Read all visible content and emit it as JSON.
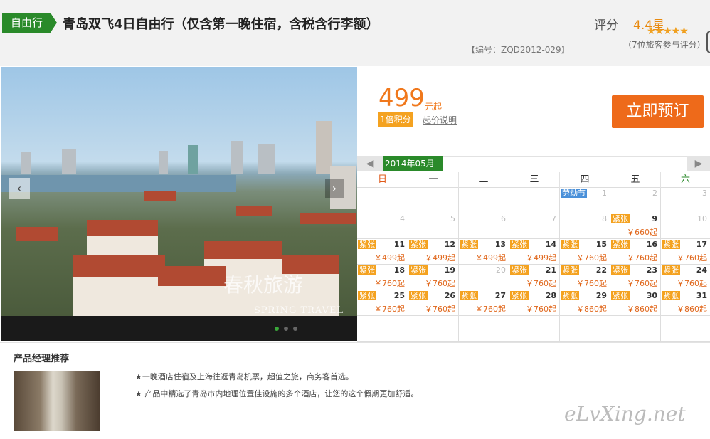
{
  "header": {
    "tag": "自由行",
    "title": "青岛双飞4日自由行（仅含第一晚住宿，含税含行李额）",
    "code": "【编号：ZQD2012-029】",
    "rating_label": "评分",
    "rating_value": "4.4星",
    "stars": "★★★★★",
    "reviews": "（7位旅客参与评分）"
  },
  "photo": {
    "watermark_cn": "春秋旅游",
    "watermark_en": "SPRING TRAVEL",
    "prev_icon": "‹",
    "next_icon": "›"
  },
  "pricing": {
    "price": "499",
    "unit": "元起",
    "points": "1倍积分",
    "price_note": "起价说明",
    "book_label": "立即预订"
  },
  "calendar": {
    "month": "2014年05月",
    "prev_icon": "◀",
    "next_icon": "▶",
    "weekdays": [
      "日",
      "一",
      "二",
      "三",
      "四",
      "五",
      "六"
    ],
    "weekday_colors": [
      "#e05a1a",
      "#333333",
      "#333333",
      "#333333",
      "#333333",
      "#333333",
      "#2a8a2a"
    ],
    "rows": [
      [
        {
          "d": ""
        },
        {
          "d": ""
        },
        {
          "d": ""
        },
        {
          "d": ""
        },
        {
          "d": "1",
          "past": true,
          "holiday": "劳动节"
        },
        {
          "d": "2",
          "past": true
        },
        {
          "d": "3",
          "past": true
        }
      ],
      [
        {
          "d": "4",
          "past": true
        },
        {
          "d": "5",
          "past": true
        },
        {
          "d": "6",
          "past": true
        },
        {
          "d": "7",
          "past": true
        },
        {
          "d": "8",
          "past": true
        },
        {
          "d": "9",
          "hot": "紧张",
          "price": "￥660起"
        },
        {
          "d": "10",
          "past": true
        }
      ],
      [
        {
          "d": "11",
          "hot": "紧张",
          "price": "￥499起"
        },
        {
          "d": "12",
          "hot": "紧张",
          "price": "￥499起"
        },
        {
          "d": "13",
          "hot": "紧张",
          "price": "￥499起"
        },
        {
          "d": "14",
          "hot": "紧张",
          "price": "￥499起"
        },
        {
          "d": "15",
          "hot": "紧张",
          "price": "￥760起"
        },
        {
          "d": "16",
          "hot": "紧张",
          "price": "￥760起"
        },
        {
          "d": "17",
          "hot": "紧张",
          "price": "￥760起"
        }
      ],
      [
        {
          "d": "18",
          "hot": "紧张",
          "price": "￥760起"
        },
        {
          "d": "19",
          "hot": "紧张",
          "price": "￥760起"
        },
        {
          "d": "20",
          "past": true
        },
        {
          "d": "21",
          "hot": "紧张",
          "price": "￥760起"
        },
        {
          "d": "22",
          "hot": "紧张",
          "price": "￥760起"
        },
        {
          "d": "23",
          "hot": "紧张",
          "price": "￥760起"
        },
        {
          "d": "24",
          "hot": "紧张",
          "price": "￥760起"
        }
      ],
      [
        {
          "d": "25",
          "hot": "紧张",
          "price": "￥760起"
        },
        {
          "d": "26",
          "hot": "紧张",
          "price": "￥760起"
        },
        {
          "d": "27",
          "hot": "紧张",
          "price": "￥760起"
        },
        {
          "d": "28",
          "hot": "紧张",
          "price": "￥760起"
        },
        {
          "d": "29",
          "hot": "紧张",
          "price": "￥860起"
        },
        {
          "d": "30",
          "hot": "紧张",
          "price": "￥860起"
        },
        {
          "d": "31",
          "hot": "紧张",
          "price": "￥860起"
        }
      ],
      [
        {
          "d": ""
        },
        {
          "d": ""
        },
        {
          "d": ""
        },
        {
          "d": ""
        },
        {
          "d": ""
        },
        {
          "d": ""
        },
        {
          "d": ""
        }
      ]
    ]
  },
  "recommend": {
    "title": "产品经理推荐",
    "tips": [
      "★一晚酒店住宿及上海往返青岛机票，超值之旅，商务客首选。",
      "★ 产品中精选了青岛市内地理位置佳设施的多个酒店，让您的这个假期更加舒适。"
    ]
  },
  "brand": "eLvXing.net"
}
